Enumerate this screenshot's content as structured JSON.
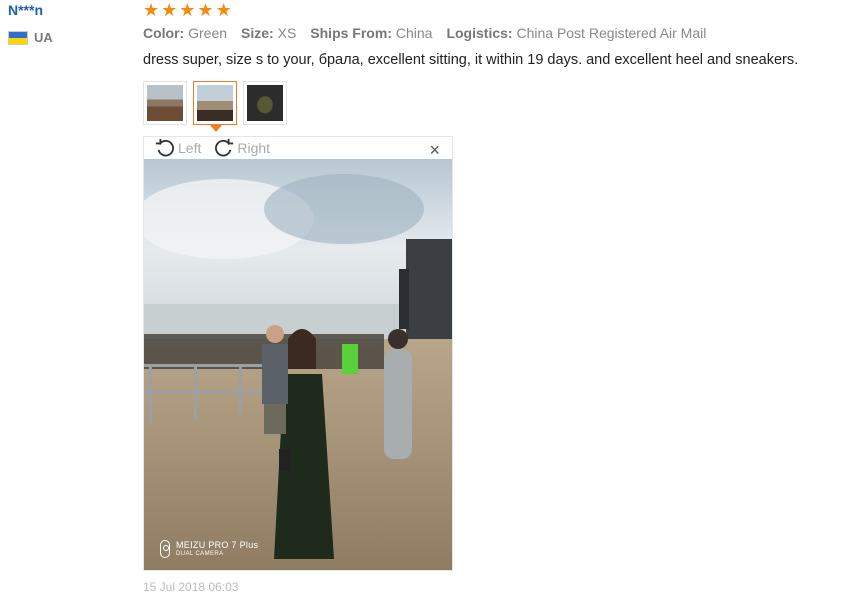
{
  "user": {
    "name": "N***n",
    "country": "UA"
  },
  "rating": {
    "stars": 5,
    "star_color": "#f78a0c"
  },
  "meta": {
    "color_label": "Color:",
    "color_value": "Green",
    "size_label": "Size:",
    "size_value": "XS",
    "ships_label": "Ships From:",
    "ships_value": "China",
    "logistics_label": "Logistics:",
    "logistics_value": "China Post Registered Air Mail"
  },
  "review_text": "dress super, size s to your, брала, excellent sitting, it within 19 days. and excellent heel and sneakers.",
  "thumbnails": [
    {
      "name": "photo-1",
      "active": false
    },
    {
      "name": "photo-2",
      "active": true
    },
    {
      "name": "photo-3",
      "active": false
    }
  ],
  "viewer": {
    "rotate_left": "Left",
    "rotate_right": "Right",
    "close_glyph": "×",
    "watermark_line1": "MEIZU PRO 7 Plus",
    "watermark_line2": "DUAL CAMERA"
  },
  "timestamp": "15 Jul 2018 06:03",
  "colors": {
    "username": "#1f5fb0",
    "accent": "#f07c26"
  }
}
